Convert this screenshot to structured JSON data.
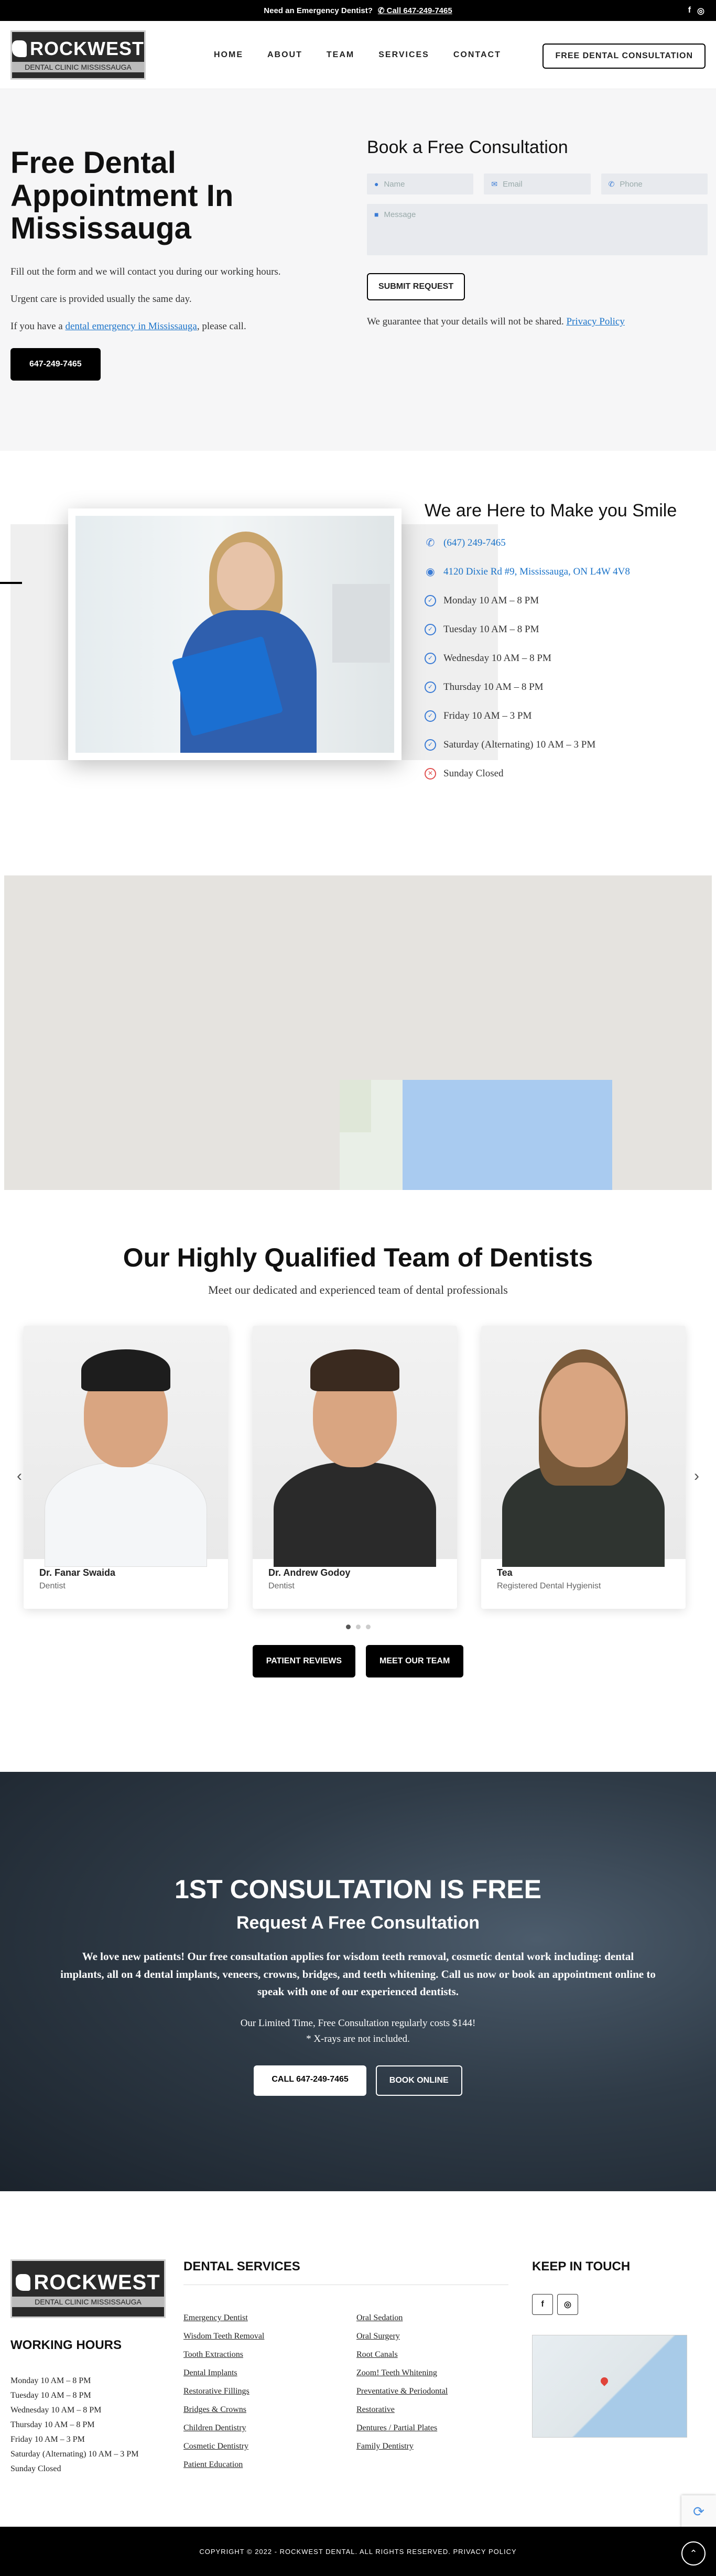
{
  "topbar": {
    "emergency": "Need an Emergency Dentist?",
    "phone": "Call 647-249-7465",
    "social": [
      "f",
      "◎"
    ]
  },
  "brand": {
    "name": "ROCKWEST",
    "tagline": "DENTAL CLINIC MISSISSAUGA"
  },
  "nav": [
    "HOME",
    "ABOUT",
    "TEAM",
    "SERVICES",
    "CONTACT"
  ],
  "header_cta": "FREE DENTAL CONSULTATION",
  "hero": {
    "title": "Free Dental Appointment In Mississauga",
    "p1": "Fill out the form and we will contact you during our working hours.",
    "p2": "Urgent care is provided usually the same day.",
    "p3_pre": "If you have a ",
    "p3_link": "dental emergency in Mississauga",
    "p3_post": ", please call.",
    "phone_btn": "647-249-7465"
  },
  "form": {
    "title": "Book a Free Consultation",
    "name_ph": "Name",
    "email_ph": "Email",
    "phone_ph": "Phone",
    "message_ph": "Message",
    "submit": "SUBMIT REQUEST",
    "guarantee": "We guarantee that your details will not be shared. ",
    "privacy": "Privacy Policy"
  },
  "smile": {
    "title": "We are Here to Make you Smile",
    "phone": "(647) 249-7465",
    "address": "4120 Dixie Rd #9, Mississauga, ON L4W 4V8",
    "hours": [
      "Monday 10 AM – 8 PM",
      "Tuesday 10 AM – 8 PM",
      "Wednesday 10 AM – 8 PM",
      "Thursday 10 AM – 8 PM",
      "Friday 10 AM – 3 PM",
      "Saturday (Alternating) 10 AM – 3 PM"
    ],
    "closed": "Sunday Closed"
  },
  "team": {
    "title": "Our Highly Qualified Team of Dentists",
    "subtitle": "Meet our dedicated and experienced team of dental professionals",
    "members": [
      {
        "name": "Dr. Fanar Swaida",
        "role": "Dentist",
        "torso": "#f4f6f8"
      },
      {
        "name": "Dr. Andrew Godoy",
        "role": "Dentist",
        "torso": "#2a2a2a"
      },
      {
        "name": "Tea",
        "role": "Registered Dental Hygienist",
        "torso": "#2f3430"
      }
    ],
    "btn_reviews": "PATIENT REVIEWS",
    "btn_team": "MEET OUR TEAM"
  },
  "consult": {
    "title": "1ST CONSULTATION IS FREE",
    "subtitle": "Request A Free Consultation",
    "lead": "We love new patients! Our free consultation applies for wisdom teeth removal, cosmetic dental work including: dental implants, all on 4 dental implants, veneers, crowns, bridges, and teeth whitening. Call us now or book an appointment online to speak with one of our experienced dentists.",
    "note1": "Our Limited Time, Free Consultation regularly costs $144!",
    "note2": "* X-rays are not included.",
    "btn_call": "CALL 647-249-7465",
    "btn_book": "BOOK ONLINE"
  },
  "footer": {
    "hours_title": "WORKING HOURS",
    "hours": [
      "Monday 10 AM – 8 PM",
      "Tuesday 10 AM – 8 PM",
      "Wednesday 10 AM – 8 PM",
      "Thursday 10 AM – 8 PM",
      "Friday 10 AM – 3 PM",
      "Saturday (Alternating) 10 AM – 3 PM",
      "Sunday Closed"
    ],
    "services_title": "DENTAL SERVICES",
    "services": [
      "Emergency Dentist",
      "Oral Sedation",
      "Wisdom Teeth Removal",
      "Oral Surgery",
      "Tooth Extractions",
      "Root Canals",
      "Dental Implants",
      "Zoom! Teeth Whitening",
      "Restorative Fillings",
      "Preventative & Periodontal",
      "Bridges & Crowns",
      "Restorative",
      "Children Dentistry",
      "Dentures / Partial Plates",
      "Cosmetic Dentistry",
      "Family Dentistry",
      "Patient Education",
      ""
    ],
    "keep_title": "KEEP IN TOUCH",
    "copyright": "COPYRIGHT © 2022 - ROCKWEST DENTAL. ALL RIGHTS RESERVED. PRIVACY POLICY"
  }
}
